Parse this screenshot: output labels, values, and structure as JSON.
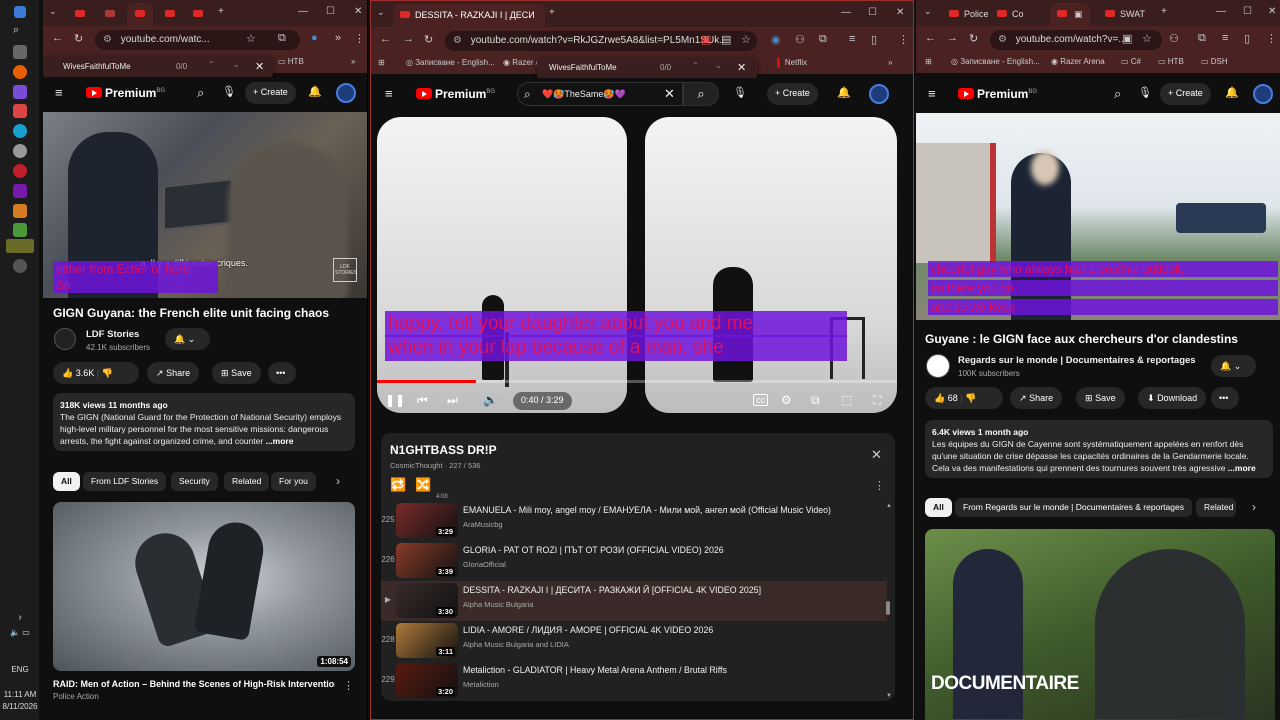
{
  "taskbar": {
    "language": "ENG",
    "time": "11:11 AM",
    "date": "8/11/2026"
  },
  "left_window": {
    "url": "youtube.com/watc...",
    "bookmark": "HTB",
    "find": {
      "query": "WivesFaithfulToMe",
      "count": "0/0"
    },
    "brand": "Premium",
    "brand_badge": "BG",
    "create_label": "Create",
    "overlay_text": "...a. Il y a différentes criques.",
    "caption_lines": [
      "either from Echer or here",
      "So"
    ],
    "watermark": "LDF STORIES",
    "video_title": "GIGN Guyana: the French elite unit facing chaos",
    "channel": "LDF Stories",
    "subscribers": "42.1K subscribers",
    "likes": "3.6K",
    "share_label": "Share",
    "save_label": "Save",
    "desc_meta": "318K views  11 months ago",
    "desc_text": "The GIGN (National Guard for the Protection of National Security) employs high-level military personnel for the most sensitive missions: dangerous arrests, the fight against organized crime, and counter",
    "more_label": "...more",
    "chips": [
      "All",
      "From LDF Stories",
      "Security",
      "Related",
      "For you"
    ],
    "rec_duration": "1:08:54",
    "rec_title": "RAID: Men of Action – Behind the Scenes of High-Risk Interventions",
    "rec_channel": "Police Action"
  },
  "middle_window": {
    "tab_title": "DESSITA - RAZKAJI I | ДЕСИ",
    "url": "youtube.com/watch?v=RkJGZrwe5A8&list=PL5Mn1SUk...",
    "bookmarks": [
      "Записване - English...",
      "Razer A",
      "Netflix"
    ],
    "find": {
      "query": "WivesFaithfulToMe",
      "count": "0/0"
    },
    "brand": "Premium",
    "brand_badge": "BG",
    "search_value": "❤️🥵TheSame🥵💜",
    "create_label": "Create",
    "caption_lines": [
      "happy, tell your daughter about you and me,",
      "when in your lap because of a man, she"
    ],
    "time_current": "0:40",
    "time_total": "3:29",
    "progress": 0.19,
    "playlist": {
      "title": "N1GHTBASS DR!P",
      "owner": "CosmicThought",
      "position": "227 / 536",
      "top_duration": "4:08",
      "items": [
        {
          "num": "225",
          "title": "EMANUELA - Mili moy, angel moy / ЕМАНУЕЛА - Мили мой, ангел мой (Official Music Video)",
          "channel": "AraMusicbg",
          "duration": "3:29",
          "current": false,
          "color": "#7a2a2a"
        },
        {
          "num": "226",
          "title": "GLORIA - PAT OT ROZI | ПЪТ ОТ РОЗИ (OFFICIAL VIDEO) 2026",
          "channel": "GloriaOfficial",
          "duration": "3:39",
          "current": false,
          "color": "#8a3b2a"
        },
        {
          "num": "▶",
          "title": "DESSITA - RAZKAJI I | ДЕСИТА - РАЗКАЖИ Й [OFFICIAL 4K VIDEO 2025]",
          "channel": "Alpha Music Bulgaria",
          "duration": "3:30",
          "current": true,
          "color": "#3a2a2a"
        },
        {
          "num": "228",
          "title": "LIDIA - AMORE / ЛИДИЯ - АМОРЕ | OFFICIAL 4K VIDEO 2026",
          "channel": "Alpha Music Bulgaria and LIDIA",
          "duration": "3:11",
          "current": false,
          "color": "#b07a3a"
        },
        {
          "num": "229",
          "title": "Metaliction - GLADIATOR | Heavy Metal Arena Anthem / Brutal Riffs",
          "channel": "Metaliction",
          "duration": "3:20",
          "current": false,
          "color": "#5a1a10"
        }
      ]
    }
  },
  "right_window": {
    "tabs": [
      "Police",
      "Co",
      "SWAT"
    ],
    "url": "youtube.com/watch?v=...",
    "bookmarks": [
      "Записване - English...",
      "Razer Arena",
      "C#",
      "HTB",
      "DSH"
    ],
    "brand": "Premium",
    "brand_badge": "BG",
    "create_label": "Create",
    "caption_lines": [
      "cheerful guy who always had a positive outlook,",
      "so there you go,",
      "and so we keep"
    ],
    "video_title": "Guyane : le GIGN face aux chercheurs d'or clandestins",
    "channel": "Regards sur le monde | Documentaires & reportages",
    "subscribers": "100K subscribers",
    "likes": "68",
    "share_label": "Share",
    "save_label": "Save",
    "download_label": "Download",
    "desc_meta": "6.4K views  1 month ago",
    "desc_text": "Les équipes du GIGN de Cayenne sont systématiquement appelées en renfort dès qu'une situation de crise dépasse les capacités ordinaires de la Gendarmerie locale. Cela va des manifestations qui prennent des tournures souvent très agressive",
    "more_label": "...more",
    "chips": [
      "All",
      "From Regards sur le monde | Documentaires & reportages",
      "Related"
    ],
    "rec_overlay": "DOCUMENTAIRE"
  },
  "colors": {
    "accent": "#ff0000",
    "caption_bg": "#6e14dc",
    "caption_text": "#e0105a",
    "chrome": "#4a2222"
  }
}
